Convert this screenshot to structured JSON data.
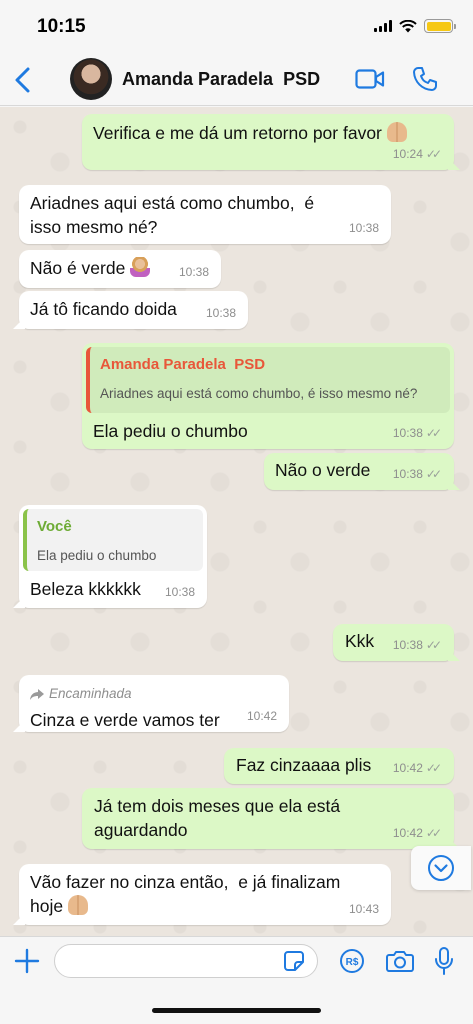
{
  "status_bar": {
    "time": "10:15"
  },
  "header": {
    "contact_name": "Amanda Paradela  PSD",
    "colors": {
      "accent": "#1f7ae0"
    }
  },
  "messages": [
    {
      "dir": "out",
      "text": "Verifica e me dá um retorno por favor",
      "emoji": "folded-hands",
      "time": "10:24"
    },
    {
      "dir": "in",
      "text": "Ariadnes aqui está como chumbo,  é isso mesmo né?",
      "time": "10:38"
    },
    {
      "dir": "in",
      "text": "Não é verde",
      "emoji": "person-facepalming",
      "time": "10:38"
    },
    {
      "dir": "in",
      "text": "Já tô ficando doida",
      "time": "10:38"
    },
    {
      "dir": "out",
      "quote_author": "Amanda Paradela  PSD",
      "quote_text": "Ariadnes aqui está como chumbo,  é isso mesmo né?",
      "text": "Ela pediu o chumbo",
      "time": "10:38"
    },
    {
      "dir": "out",
      "text": "Não o verde",
      "time": "10:38"
    },
    {
      "dir": "in",
      "quote_author": "Você",
      "quote_text": "Ela pediu o chumbo",
      "text": "Beleza kkkkkk",
      "time": "10:38"
    },
    {
      "dir": "out",
      "text": "Kkk",
      "time": "10:38"
    },
    {
      "dir": "in",
      "forwarded_label": "Encaminhada",
      "text": "Cinza e verde vamos ter",
      "time": "10:42"
    },
    {
      "dir": "out",
      "text": "Faz cinzaaaa plis",
      "time": "10:42"
    },
    {
      "dir": "out",
      "text": "Já tem dois meses que ela está aguardando",
      "time": "10:42"
    },
    {
      "dir": "in",
      "text": "Vão fazer no cinza então,  e já finalizam hoje",
      "emoji": "folded-hands",
      "time": "10:43"
    }
  ],
  "input": {
    "value": "",
    "placeholder": ""
  },
  "colors": {
    "outgoing_bubble": "#dcf8c6",
    "incoming_bubble": "#ffffff",
    "chat_background": "#ebe5de",
    "quote_outgoing_author": "#e8573a",
    "quote_incoming_author": "#6dab35"
  }
}
